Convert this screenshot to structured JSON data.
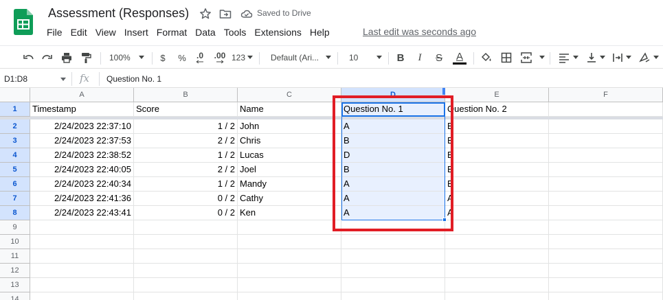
{
  "header": {
    "title": "Assessment (Responses)",
    "saved_status": "Saved to Drive",
    "last_edit": "Last edit was seconds ago"
  },
  "menu": [
    "File",
    "Edit",
    "View",
    "Insert",
    "Format",
    "Data",
    "Tools",
    "Extensions",
    "Help"
  ],
  "toolbar": {
    "zoom": "100%",
    "currency": "$",
    "percent": "%",
    "decrease_decimal": ".0",
    "increase_decimal": ".00",
    "more_formats": "123",
    "font_family": "Default (Ari...",
    "font_size": "10",
    "bold": "B",
    "italic": "I",
    "strikethrough": "S",
    "text_color": "A"
  },
  "formula_bar": {
    "name_box": "D1:D8",
    "fx": "fx",
    "value": "Question No. 1"
  },
  "colors": {
    "selection": "#1a73e8",
    "selection_fill": "#e8f0fe",
    "highlight_box": "#e11d25",
    "sheets_green": "#0f9d58"
  },
  "grid": {
    "columns": [
      "A",
      "B",
      "C",
      "D",
      "E",
      "F"
    ],
    "row_numbers": [
      "1",
      "2",
      "3",
      "4",
      "5",
      "6",
      "7",
      "8",
      "9",
      "10",
      "11",
      "12",
      "13",
      "14"
    ],
    "header_row": [
      "Timestamp",
      "Score",
      "Name",
      "Question No. 1",
      "Question No. 2",
      ""
    ],
    "rows": [
      [
        "2/24/2023 22:37:10",
        "1 / 2",
        "John",
        "A",
        "B"
      ],
      [
        "2/24/2023 22:37:53",
        "2 / 2",
        "Chris",
        "B",
        "B"
      ],
      [
        "2/24/2023 22:38:52",
        "1 / 2",
        "Lucas",
        "D",
        "B"
      ],
      [
        "2/24/2023 22:40:05",
        "2 / 2",
        "Joel",
        "B",
        "B"
      ],
      [
        "2/24/2023 22:40:34",
        "1 / 2",
        "Mandy",
        "A",
        "B"
      ],
      [
        "2/24/2023 22:41:36",
        "0 / 2",
        "Cathy",
        "A",
        "A"
      ],
      [
        "2/24/2023 22:43:41",
        "0 / 2",
        "Ken",
        "A",
        "A"
      ]
    ],
    "selected_range": "D1:D8"
  }
}
